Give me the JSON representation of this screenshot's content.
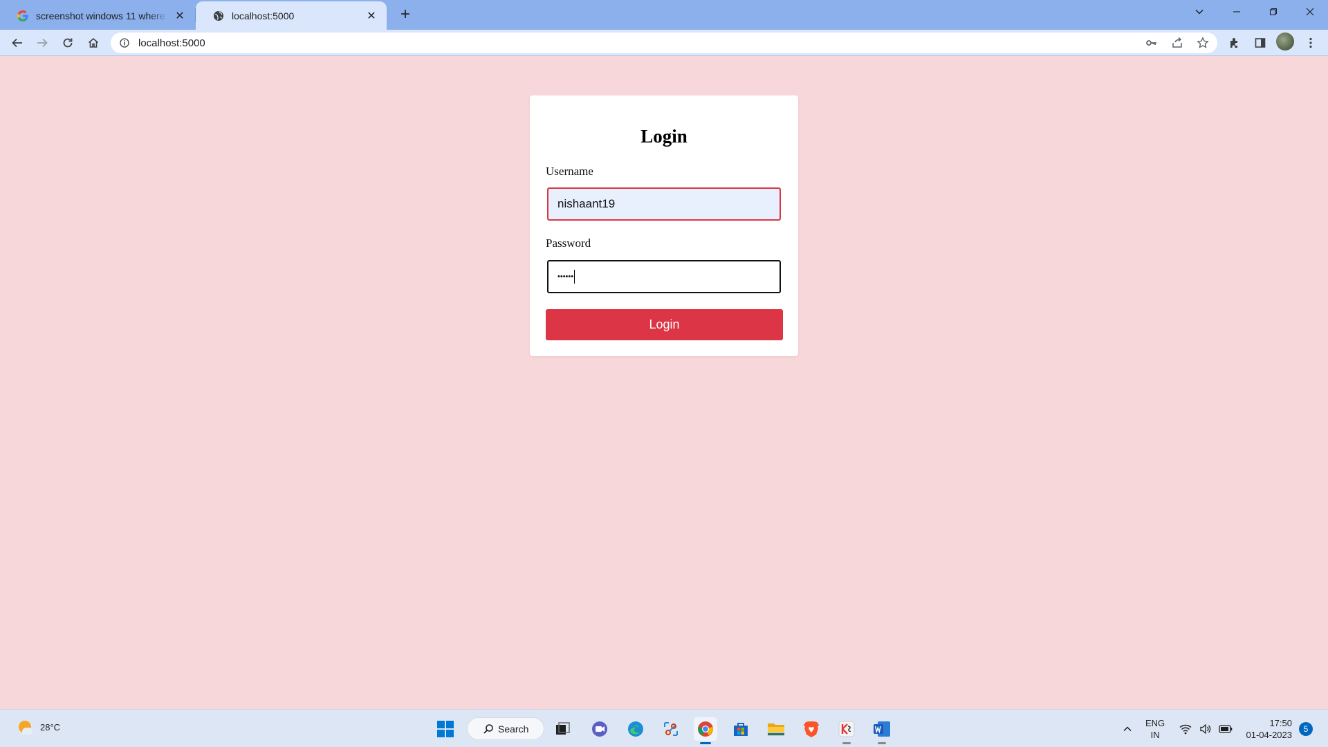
{
  "browser": {
    "tabs": [
      {
        "title": "screenshot windows 11 where do",
        "active": false,
        "icon": "google-g-icon"
      },
      {
        "title": "localhost:5000",
        "active": true,
        "icon": "globe-icon"
      }
    ],
    "new_tab_label": "+",
    "url": "localhost:5000"
  },
  "page": {
    "heading": "Login",
    "username_label": "Username",
    "username_value": "nishaant19",
    "password_label": "Password",
    "password_masked": "••••••",
    "login_button": "Login",
    "colors": {
      "background": "#f8d7da",
      "button": "#dc3545",
      "username_border": "#dc3545"
    }
  },
  "taskbar": {
    "weather_temp": "28°C",
    "search_label": "Search",
    "apps": [
      "start",
      "search",
      "task-view",
      "teams-chat",
      "edge",
      "snipping-tool",
      "chrome",
      "microsoft-store",
      "file-explorer",
      "brave",
      "kinemaster",
      "word"
    ],
    "language": "ENG",
    "region": "IN",
    "time": "17:50",
    "date": "01-04-2023",
    "notification_count": "5"
  }
}
